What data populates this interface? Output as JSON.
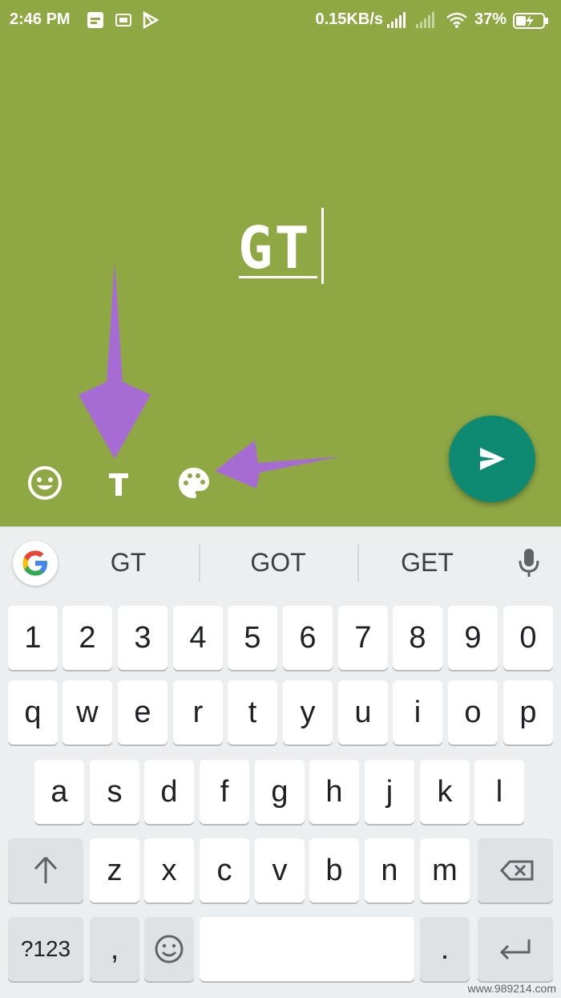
{
  "status_bar": {
    "time": "2:46 PM",
    "network_speed": "0.15KB/s",
    "battery_percent": "37%",
    "icons": [
      "gallery-icon",
      "sim-icon",
      "play-store-icon",
      "signal-icon",
      "signal-weak-icon",
      "wifi-icon",
      "battery-charging-icon"
    ]
  },
  "story": {
    "background_color": "#8fa844",
    "text": "GT",
    "tools": [
      {
        "name": "emoji-icon"
      },
      {
        "name": "text-style-icon",
        "glyph": "T"
      },
      {
        "name": "palette-icon"
      }
    ],
    "send_button_color": "#0e8a72",
    "annotation_color": "#a66cd3"
  },
  "keyboard": {
    "suggestions": [
      "GT",
      "GOT",
      "GET"
    ],
    "rows": [
      [
        "1",
        "2",
        "3",
        "4",
        "5",
        "6",
        "7",
        "8",
        "9",
        "0"
      ],
      [
        "q",
        "w",
        "e",
        "r",
        "t",
        "y",
        "u",
        "i",
        "o",
        "p"
      ],
      [
        "a",
        "s",
        "d",
        "f",
        "g",
        "h",
        "j",
        "k",
        "l"
      ],
      [
        "z",
        "x",
        "c",
        "v",
        "b",
        "n",
        "m"
      ]
    ],
    "symbols_key": "?123",
    "comma_key": ",",
    "period_key": "."
  },
  "watermark": "www.989214.com"
}
